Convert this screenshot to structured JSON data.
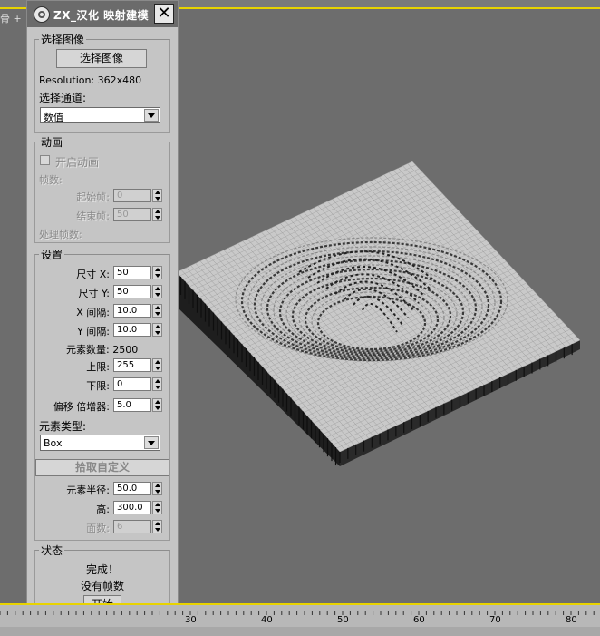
{
  "viewport": {
    "label": "骨 +"
  },
  "window": {
    "title": "ZX_汉化 映射建模",
    "close": "✕"
  },
  "select_image": {
    "legend": "选择图像",
    "button": "选择图像",
    "resolution": "Resolution: 362x480",
    "channel_label": "选择通道:",
    "channel_value": "数值"
  },
  "animation": {
    "legend": "动画",
    "enable": "开启动画",
    "frames": "帧数:",
    "start_label": "起始帧:",
    "start_value": "0",
    "end_label": "结束帧:",
    "end_value": "50",
    "process_frames": "处理帧数:"
  },
  "settings": {
    "legend": "设置",
    "size_x_label": "尺寸 X:",
    "size_x": "50",
    "size_y_label": "尺寸 Y:",
    "size_y": "50",
    "gap_x_label": "X 间隔:",
    "gap_x": "10.0",
    "gap_y_label": "Y 间隔:",
    "gap_y": "10.0",
    "count": "元素数量: 2500",
    "upper_label": "上限:",
    "upper": "255",
    "lower_label": "下限:",
    "lower": "0",
    "offset_label": "偏移 倍增器:",
    "offset": "5.0",
    "type_label": "元素类型:",
    "type_value": "Box",
    "pick_custom": "拾取自定义",
    "radius_label": "元素半径:",
    "radius": "50.0",
    "height_label": "高:",
    "height": "300.0",
    "faces_label": "面数:",
    "faces": "6"
  },
  "status": {
    "legend": "状态",
    "done": "完成！",
    "no_frames": "没有帧数",
    "start_button": "开始"
  },
  "timeline": {
    "ticks": [
      "30",
      "40",
      "50",
      "60",
      "70",
      "80"
    ]
  }
}
